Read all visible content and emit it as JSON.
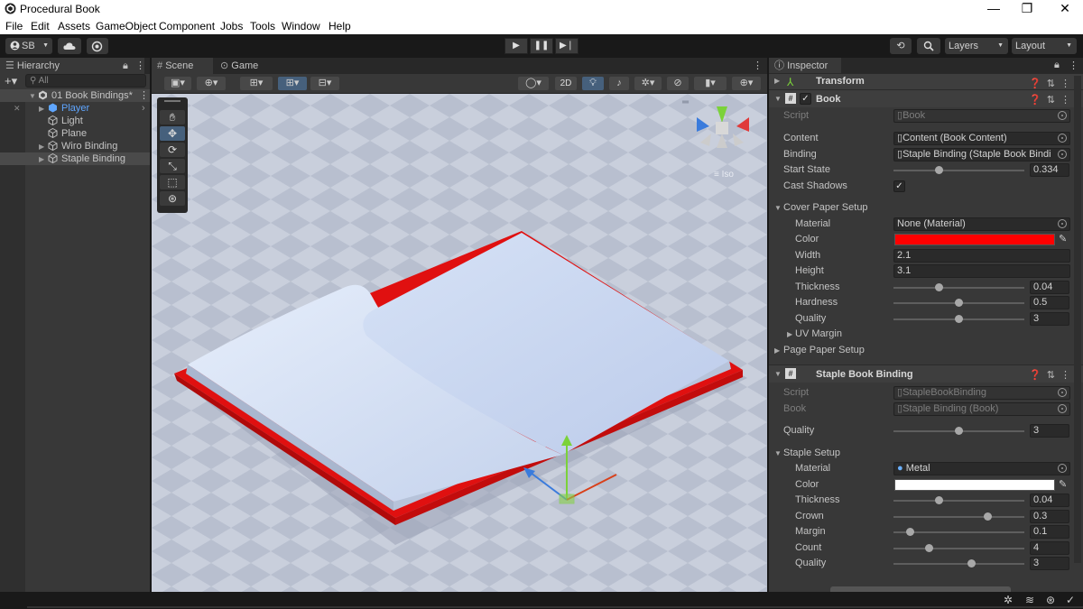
{
  "window": {
    "title": "Procedural Book",
    "minimize": "—",
    "restore": "❐",
    "close": "✕"
  },
  "menu": [
    "File",
    "Edit",
    "Assets",
    "GameObject",
    "Component",
    "Jobs",
    "Tools",
    "Window",
    "Help"
  ],
  "toolbar": {
    "account": "SB",
    "layers": "Layers",
    "layout": "Layout"
  },
  "hierarchy": {
    "tab": "Hierarchy",
    "search_placeholder": "All",
    "scene_name": "01 Book Bindings*",
    "items": [
      {
        "label": "Player",
        "color": "#5fa6ff"
      },
      {
        "label": "Light"
      },
      {
        "label": "Plane"
      },
      {
        "label": "Wiro Binding"
      },
      {
        "label": "Staple Binding"
      }
    ]
  },
  "scene": {
    "tabs": [
      "Scene",
      "Game"
    ],
    "mode_2d": "2D",
    "persp_label": "≡ Iso"
  },
  "inspector": {
    "tab": "Inspector",
    "transform": "Transform",
    "book": {
      "header": "Book",
      "script_label": "Script",
      "script_value": "Book",
      "content_label": "Content",
      "content_value": "Content (Book Content)",
      "binding_label": "Binding",
      "binding_value": "Staple Binding (Staple Book Bindi",
      "start_state_label": "Start State",
      "start_state_value": "0.334",
      "cast_shadows_label": "Cast Shadows",
      "cast_shadows_check": "✓",
      "cover_setup": "Cover Paper Setup",
      "material_label": "Material",
      "material_value": "None (Material)",
      "color_label": "Color",
      "cover_color": "#ff0000",
      "width_label": "Width",
      "width_value": "2.1",
      "height_label": "Height",
      "height_value": "3.1",
      "thickness_label": "Thickness",
      "thickness_value": "0.04",
      "hardness_label": "Hardness",
      "hardness_value": "0.5",
      "quality_label": "Quality",
      "quality_value": "3",
      "uv_margin": "UV Margin",
      "page_setup": "Page Paper Setup"
    },
    "staple": {
      "header": "Staple Book Binding",
      "script_label": "Script",
      "script_value": "StapleBookBinding",
      "book_label": "Book",
      "book_value": "Staple Binding (Book)",
      "quality_label": "Quality",
      "quality_value": "3",
      "staple_setup": "Staple Setup",
      "material_label": "Material",
      "material_value": "Metal",
      "color_label": "Color",
      "staple_color": "#ffffff",
      "thickness_label": "Thickness",
      "thickness_value": "0.04",
      "crown_label": "Crown",
      "crown_value": "0.3",
      "margin_label": "Margin",
      "margin_value": "0.1",
      "count_label": "Count",
      "count_value": "4",
      "quality2_label": "Quality",
      "quality2_value": "3"
    }
  }
}
